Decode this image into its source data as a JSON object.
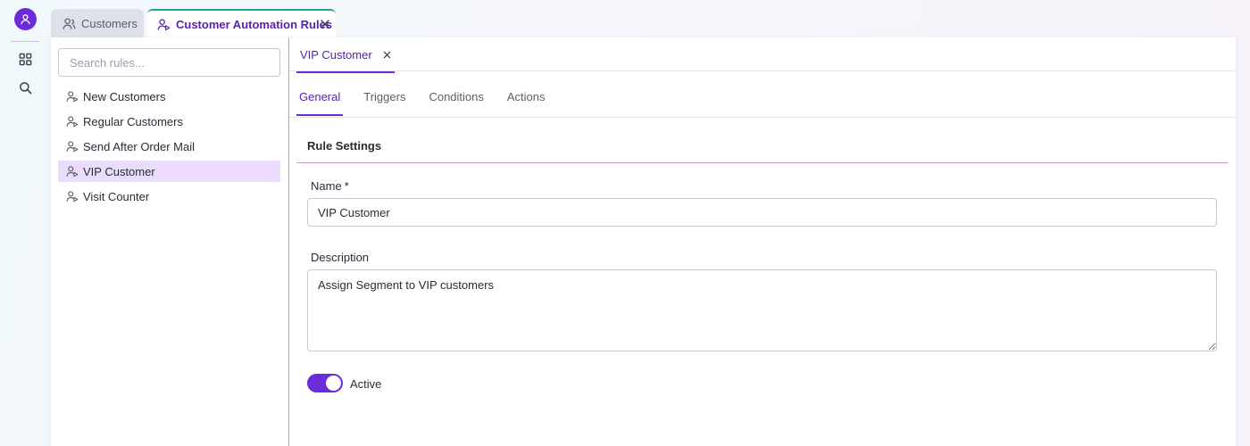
{
  "rail": {
    "icons": [
      "user-icon",
      "grid-icon",
      "search-icon"
    ],
    "accent": "#6c2bd9"
  },
  "tabs": [
    {
      "label": "Customers",
      "icon": "customer-icon",
      "active": false
    },
    {
      "label": "Customer Automation Rules",
      "icon": "customer-rule-icon",
      "active": true,
      "closable": true
    }
  ],
  "sidebar": {
    "search_placeholder": "Search rules...",
    "items": [
      {
        "label": "New Customers",
        "icon": "customer-rule-icon",
        "selected": false
      },
      {
        "label": "Regular Customers",
        "icon": "customer-rule-icon",
        "selected": false
      },
      {
        "label": "Send After Order Mail",
        "icon": "customer-rule-icon",
        "selected": false
      },
      {
        "label": "VIP Customer",
        "icon": "customer-rule-icon",
        "selected": true
      },
      {
        "label": "Visit Counter",
        "icon": "customer-rule-icon",
        "selected": false
      }
    ]
  },
  "detail": {
    "tab_label": "VIP Customer",
    "subtabs": [
      {
        "label": "General",
        "active": true
      },
      {
        "label": "Triggers",
        "active": false
      },
      {
        "label": "Conditions",
        "active": false
      },
      {
        "label": "Actions",
        "active": false
      }
    ],
    "section_title": "Rule Settings",
    "name_label": "Name",
    "required_marker": "*",
    "name_value": "VIP Customer",
    "description_label": "Description",
    "description_value": "Assign Segment to VIP customers",
    "active_label": "Active",
    "active": true
  },
  "colors": {
    "accent": "#6c2bd9",
    "accent_text": "#5b21b6",
    "selected_bg": "#ecdcfb",
    "tab_top_border": "#1ea39b"
  }
}
